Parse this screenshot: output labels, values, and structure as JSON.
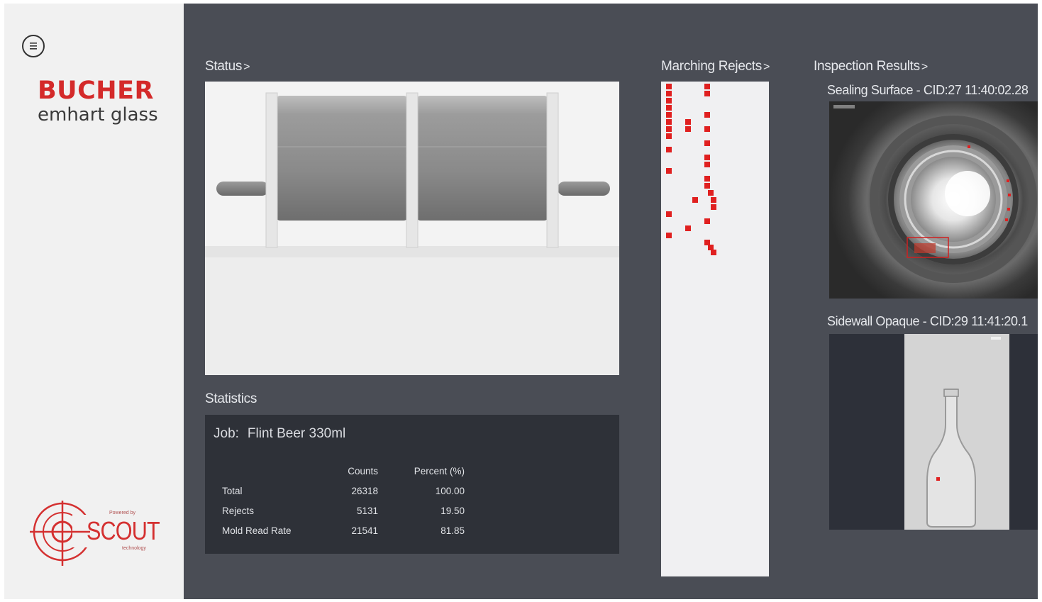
{
  "sidebar": {
    "brand_line1": "BUCHER",
    "brand_line2": "emhart glass",
    "scout": {
      "powered": "Powered by",
      "word": "SCOUT",
      "tech": "technology"
    }
  },
  "status": {
    "title": "Status",
    "chevron": ">"
  },
  "statistics": {
    "title": "Statistics",
    "job_label": "Job:",
    "job_value": "Flint Beer 330ml",
    "headers": {
      "counts": "Counts",
      "percent": "Percent (%)"
    },
    "rows": [
      {
        "label": "Total",
        "count": "26318",
        "percent": "100.00"
      },
      {
        "label": "Rejects",
        "count": "5131",
        "percent": "19.50"
      },
      {
        "label": "Mold Read Rate",
        "count": "21541",
        "percent": "81.85"
      }
    ]
  },
  "marching_rejects": {
    "title": "Marching Rejects",
    "chevron": ">"
  },
  "inspection": {
    "title": "Inspection Results",
    "chevron": ">",
    "images": [
      {
        "label": "Sealing Surface - CID:27 11:40:02.28"
      },
      {
        "label": "Sidewall Opaque - CID:29 11:41:20.1"
      }
    ]
  },
  "colors": {
    "accent": "#d42a2a",
    "background": "#4a4d55",
    "panel_dark": "#2e3138",
    "reject": "#e02020"
  },
  "icons": {
    "menu": "menu-icon",
    "logo": "scout-target-icon"
  }
}
